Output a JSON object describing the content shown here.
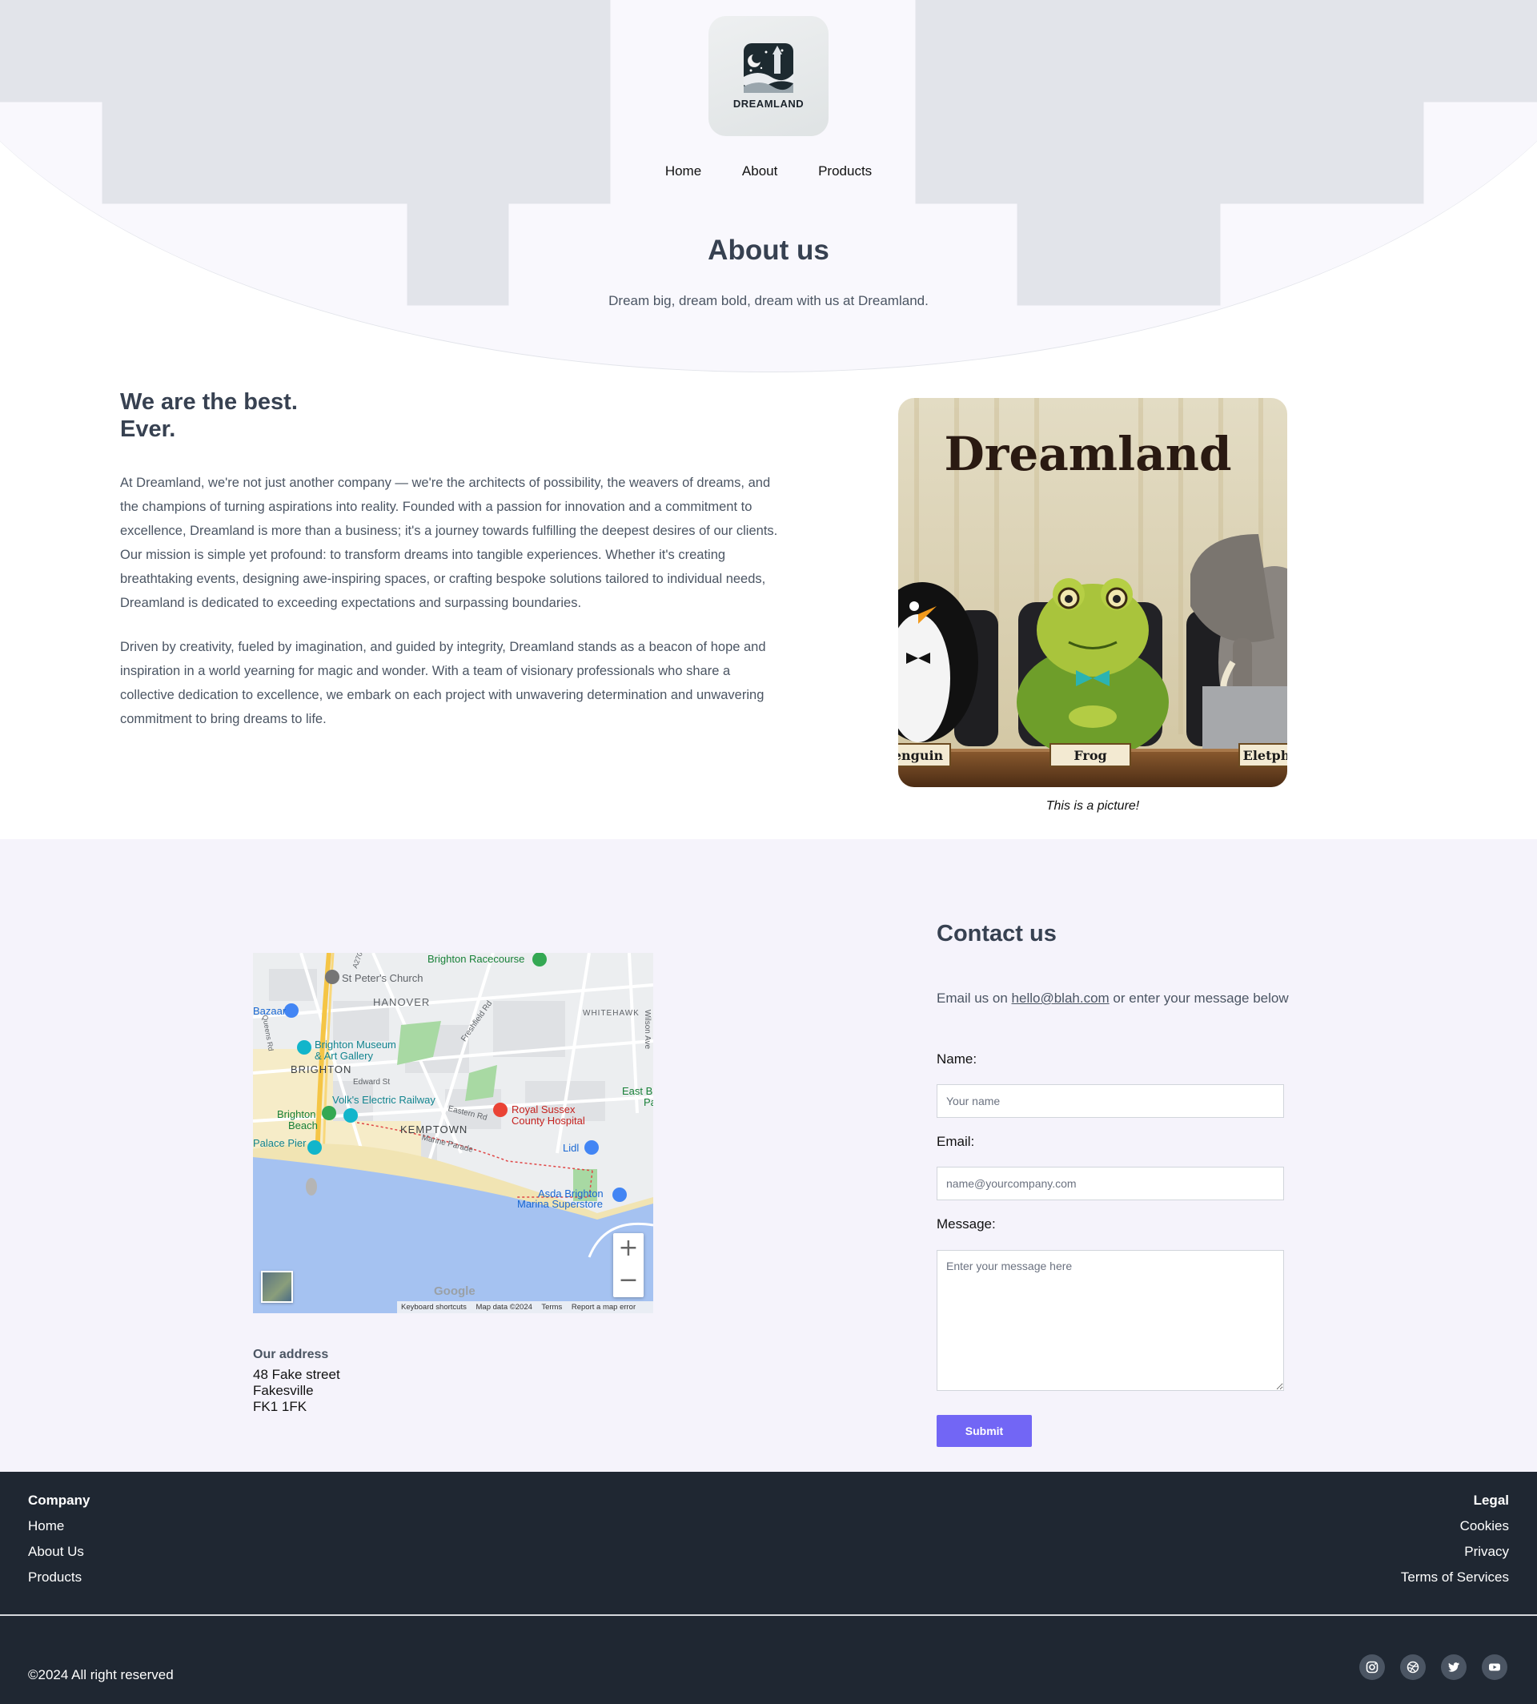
{
  "brand": {
    "name": "DREAMLAND"
  },
  "nav": {
    "items": [
      "Home",
      "About",
      "Products"
    ]
  },
  "hero": {
    "title": "About us",
    "subtitle": "Dream big, dream bold, dream with us at Dreamland."
  },
  "about": {
    "heading_line1": "We are the best.",
    "heading_line2": "Ever.",
    "paragraph1": "At Dreamland, we're not just another company — we're the architects of possibility, the weavers of dreams, and the champions of turning aspirations into reality. Founded with a passion for innovation and a commitment to excellence, Dreamland is more than a business; it's a journey towards fulfilling the deepest desires of our clients. Our mission is simple yet profound: to transform dreams into tangible experiences. Whether it's creating breathtaking events, designing awe-inspiring spaces, or crafting bespoke solutions tailored to individual needs, Dreamland is dedicated to exceeding expectations and surpassing boundaries.",
    "paragraph2": "Driven by creativity, fueled by imagination, and guided by integrity, Dreamland stands as a beacon of hope and inspiration in a world yearning for magic and wonder. With a team of visionary professionals who share a collective dedication to excellence, we embark on each project with unwavering determination and unwavering commitment to bring dreams to life.",
    "picture": {
      "sign": "Dreamland",
      "plates": [
        "enguin",
        "Frog",
        "Eletph"
      ],
      "caption": "This is a picture!"
    }
  },
  "map": {
    "labels": {
      "racecourse": "Brighton Racecourse",
      "church": "St Peter's Church",
      "hanover": "HANOVER",
      "whitehawk": "WHITEHAWK",
      "bazaar": "Bazaar",
      "museum1": "Brighton Museum",
      "museum2": "& Art Gallery",
      "brighton": "BRIGHTON",
      "edward": "Edward St",
      "volks": "Volk's Electric Railway",
      "hospital1": "Royal Sussex",
      "hospital2": "County Hospital",
      "beach1": "Brighton",
      "beach2": "Beach",
      "kemptown": "KEMPTOWN",
      "marine": "Marine Parade",
      "eastern": "Eastern Rd",
      "freshfield": "Freshfield Rd",
      "wilson": "Wilson Ave",
      "pier": "Palace Pier",
      "lidl": "Lidl",
      "asda1": "Asda Brighton",
      "asda2": "Marina Superstore",
      "eastb": "East B",
      "eastb2": "Pa",
      "queens": "Queens Rd",
      "a270": "A270"
    },
    "google": "Google",
    "footer": [
      "Keyboard shortcuts",
      "Map data ©2024",
      "Terms",
      "Report a map error"
    ],
    "zoom_in": "+",
    "zoom_out": "−"
  },
  "address": {
    "label": "Our address",
    "line1": "48 Fake street",
    "line2": "Fakesville",
    "line3": "FK1 1FK"
  },
  "contact": {
    "title": "Contact us",
    "intro_before": "Email us on ",
    "email": "hello@blah.com",
    "intro_after": " or enter your message below",
    "name_label": "Name:",
    "name_placeholder": "Your name",
    "email_label": "Email:",
    "email_placeholder": "name@yourcompany.com",
    "message_label": "Message:",
    "message_placeholder": "Enter your message here",
    "submit": "Submit"
  },
  "footer": {
    "company_heading": "Company",
    "company_links": [
      "Home",
      "About Us",
      "Products"
    ],
    "legal_heading": "Legal",
    "legal_links": [
      "Cookies",
      "Privacy",
      "Terms of Services"
    ],
    "copyright": "©2024 All right reserved",
    "social": [
      "instagram-icon",
      "dribbble-icon",
      "twitter-icon",
      "youtube-icon"
    ]
  },
  "colors": {
    "accent": "#7266f5",
    "footer_bg": "#1f2732",
    "hero_bg": "#f9f8fd",
    "contact_bg": "#f5f3fb"
  }
}
